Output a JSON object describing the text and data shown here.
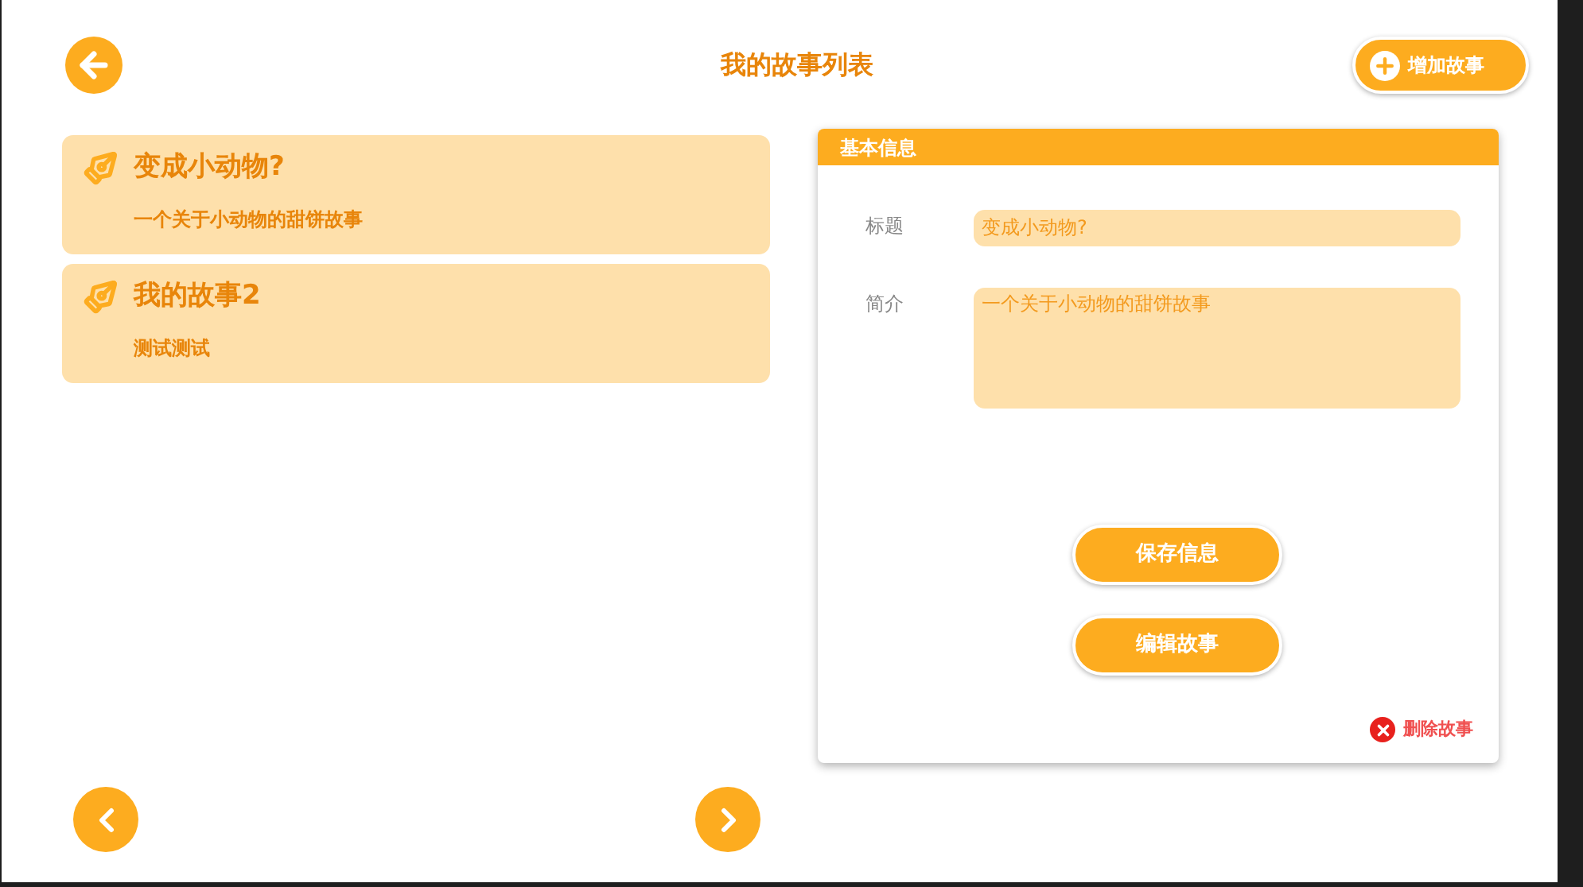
{
  "header": {
    "title": "我的故事列表",
    "add_button": "增加故事"
  },
  "stories": [
    {
      "title": "变成小动物?",
      "description": "一个关于小动物的甜饼故事"
    },
    {
      "title": "我的故事2",
      "description": "测试测试"
    }
  ],
  "detail_panel": {
    "heading": "基本信息",
    "fields": [
      {
        "label": "标题",
        "value": "变成小动物?",
        "kind": "line"
      },
      {
        "label": "简介",
        "value": "一个关于小动物的甜饼故事",
        "kind": "area"
      }
    ],
    "buttons": [
      "保存信息",
      "编辑故事"
    ],
    "delete_link": "删除故事"
  }
}
